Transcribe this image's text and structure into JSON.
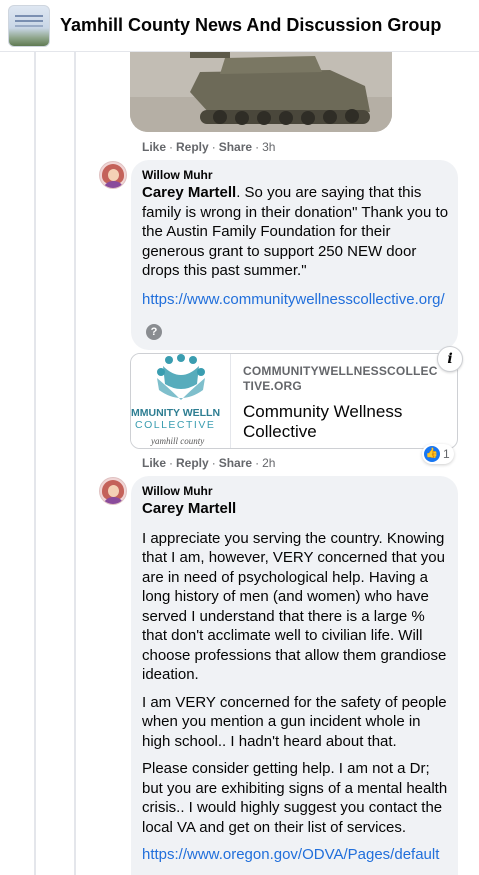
{
  "header": {
    "title": "Yamhill County News And Discussion Group",
    "avatar_icon": "group-cover-icon"
  },
  "comment1_actions": {
    "like": "Like",
    "reply": "Reply",
    "share": "Share",
    "time": "3h"
  },
  "comment2": {
    "author": "Willow Muhr",
    "mention": "Carey Martell",
    "text": ". So you are saying that this family is wrong in their donation\" Thank you to the Austin Family Foundation for their generous grant to support 250 NEW door drops this past summer.\"",
    "link": "https://www.communitywellnesscollective.org/",
    "question_icon": "?",
    "preview": {
      "domain": "COMMUNITYWELLNESSCOLLECTIVE.ORG",
      "title": "Community Wellness Collective",
      "logo_line1": "MMUNITY WELLN",
      "logo_line2": "COLLECTIVE",
      "logo_line3": "yamhill county"
    },
    "info_icon": "i",
    "actions": {
      "like": "Like",
      "reply": "Reply",
      "share": "Share",
      "time": "2h"
    },
    "reaction_count": "1"
  },
  "comment3": {
    "author": "Willow Muhr",
    "mention": "Carey Martell",
    "paragraphs": [
      "I appreciate you serving the country. Knowing that I am, however, VERY concerned that you are in need of psychological help. Having a long history of men (and women) who have served I understand that there is a large % that don't acclimate well to civilian life. Will choose professions that allow them grandiose ideation.",
      "I am VERY concerned for the safety of people when you mention a gun incident whole in high school.. I hadn't heard about that.",
      "Please consider getting help. I am not a Dr; but you are exhibiting signs of a mental health crisis.. I would highly suggest you contact the local VA and get on their list of services."
    ],
    "link": "https://www.oregon.gov/ODVA/Pages/default"
  },
  "colors": {
    "link": "#216fdb",
    "bubble": "#f0f2f5",
    "meta": "#65676b",
    "like_blue": "#1877f2",
    "logo_teal": "#3a9db0"
  }
}
